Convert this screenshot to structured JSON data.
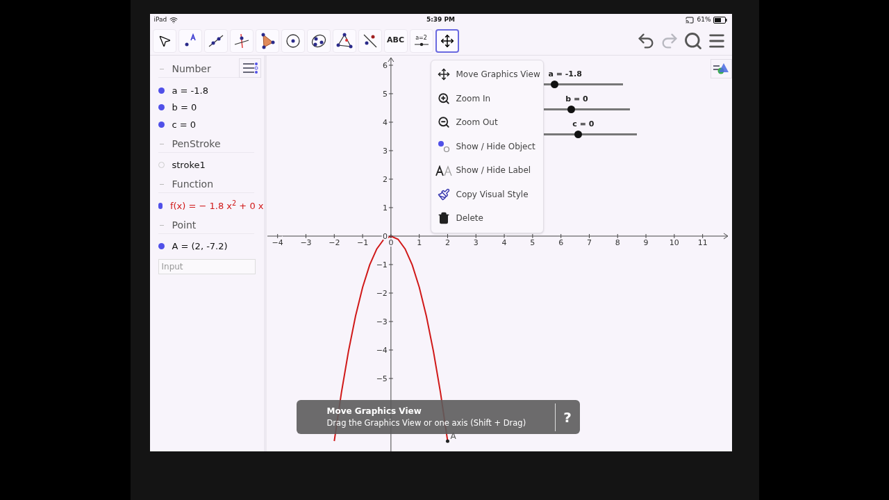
{
  "status_bar": {
    "device": "iPad",
    "time": "5:39 PM",
    "battery": "61%"
  },
  "toolbar": {
    "tools": [
      {
        "kind": "pointer",
        "selected": false
      },
      {
        "kind": "point",
        "selected": false
      },
      {
        "kind": "line",
        "selected": false
      },
      {
        "kind": "perpendicular",
        "selected": false
      },
      {
        "kind": "polygon",
        "selected": false
      },
      {
        "kind": "circle",
        "selected": false
      },
      {
        "kind": "conic",
        "selected": false
      },
      {
        "kind": "angle",
        "selected": false
      },
      {
        "kind": "reflect",
        "selected": false
      },
      {
        "kind": "text",
        "label": "ABC",
        "selected": false
      },
      {
        "kind": "slider",
        "label": "a=2",
        "selected": false
      },
      {
        "kind": "move",
        "selected": true
      }
    ],
    "actions": [
      {
        "kind": "undo",
        "disabled": false
      },
      {
        "kind": "redo",
        "disabled": true
      },
      {
        "kind": "search",
        "disabled": false
      },
      {
        "kind": "menu",
        "disabled": false
      }
    ]
  },
  "algebra": {
    "groups": [
      {
        "header": "Number",
        "items": [
          {
            "text": "a = -1.8",
            "visible": true,
            "color": "#111111"
          },
          {
            "text": "b = 0",
            "visible": true,
            "color": "#111111"
          },
          {
            "text": "c = 0",
            "visible": true,
            "color": "#111111"
          }
        ]
      },
      {
        "header": "PenStroke",
        "items": [
          {
            "text": "stroke1",
            "visible": false,
            "color": "#111111"
          }
        ]
      },
      {
        "header": "Function",
        "items": [
          {
            "text": "f(x) =  − 1.8 x$^{2}$ + 0 x",
            "visible": true,
            "color": "#d01818"
          }
        ]
      },
      {
        "header": "Point",
        "items": [
          {
            "text": "A = (2, -7.2)",
            "visible": true,
            "color": "#111111"
          }
        ]
      }
    ],
    "input": {
      "placeholder": "Input"
    }
  },
  "graphics": {
    "sliders": [
      {
        "label": "a = -1.8",
        "level": 0.4
      },
      {
        "label": "b = 0",
        "level": 0.49
      },
      {
        "label": "c = 0",
        "level": 0.49
      }
    ],
    "chart_data": {
      "type": "line",
      "x": [
        -2,
        -1.75,
        -1.5,
        -1.25,
        -1,
        -0.75,
        -0.5,
        -0.25,
        0,
        0.25,
        0.5,
        0.75,
        1,
        1.25,
        1.5,
        1.75,
        2
      ],
      "series": [
        {
          "color": "#d01818",
          "values": [
            -7.2,
            -5.51,
            -4.05,
            -2.81,
            -1.8,
            -1.01,
            -0.45,
            -0.11,
            0,
            -0.11,
            -0.45,
            -1.01,
            -1.8,
            -2.81,
            -4.05,
            -5.51,
            -7.2
          ]
        }
      ],
      "xlim": [
        -4.36,
        11.94
      ],
      "ylim": [
        -7.56,
        6.34
      ],
      "xticks": [
        -4,
        -3,
        -2,
        -1,
        0,
        1,
        2,
        3,
        4,
        5,
        6,
        7,
        8,
        9,
        10,
        11
      ],
      "yticks": [
        -5,
        -4,
        -3,
        -2,
        -1,
        0,
        1,
        2,
        3,
        4,
        5,
        6
      ],
      "annotations": [
        {
          "x": 2,
          "y": -7.2,
          "text": "A"
        }
      ]
    },
    "menu": [
      {
        "kind": "move",
        "label": "Move Graphics View"
      },
      {
        "kind": "zoom-in",
        "label": "Zoom In"
      },
      {
        "kind": "zoom-out",
        "label": "Zoom Out"
      },
      {
        "kind": "show-object",
        "label": "Show / Hide Object"
      },
      {
        "kind": "show-label",
        "label": "Show / Hide Label"
      },
      {
        "kind": "copy-style",
        "label": "Copy Visual Style"
      },
      {
        "kind": "delete",
        "label": "Delete"
      }
    ],
    "tooltip": {
      "title": "Move Graphics View",
      "text": "Drag the Graphics View or one axis (Shift + Drag)",
      "help": "?"
    }
  }
}
